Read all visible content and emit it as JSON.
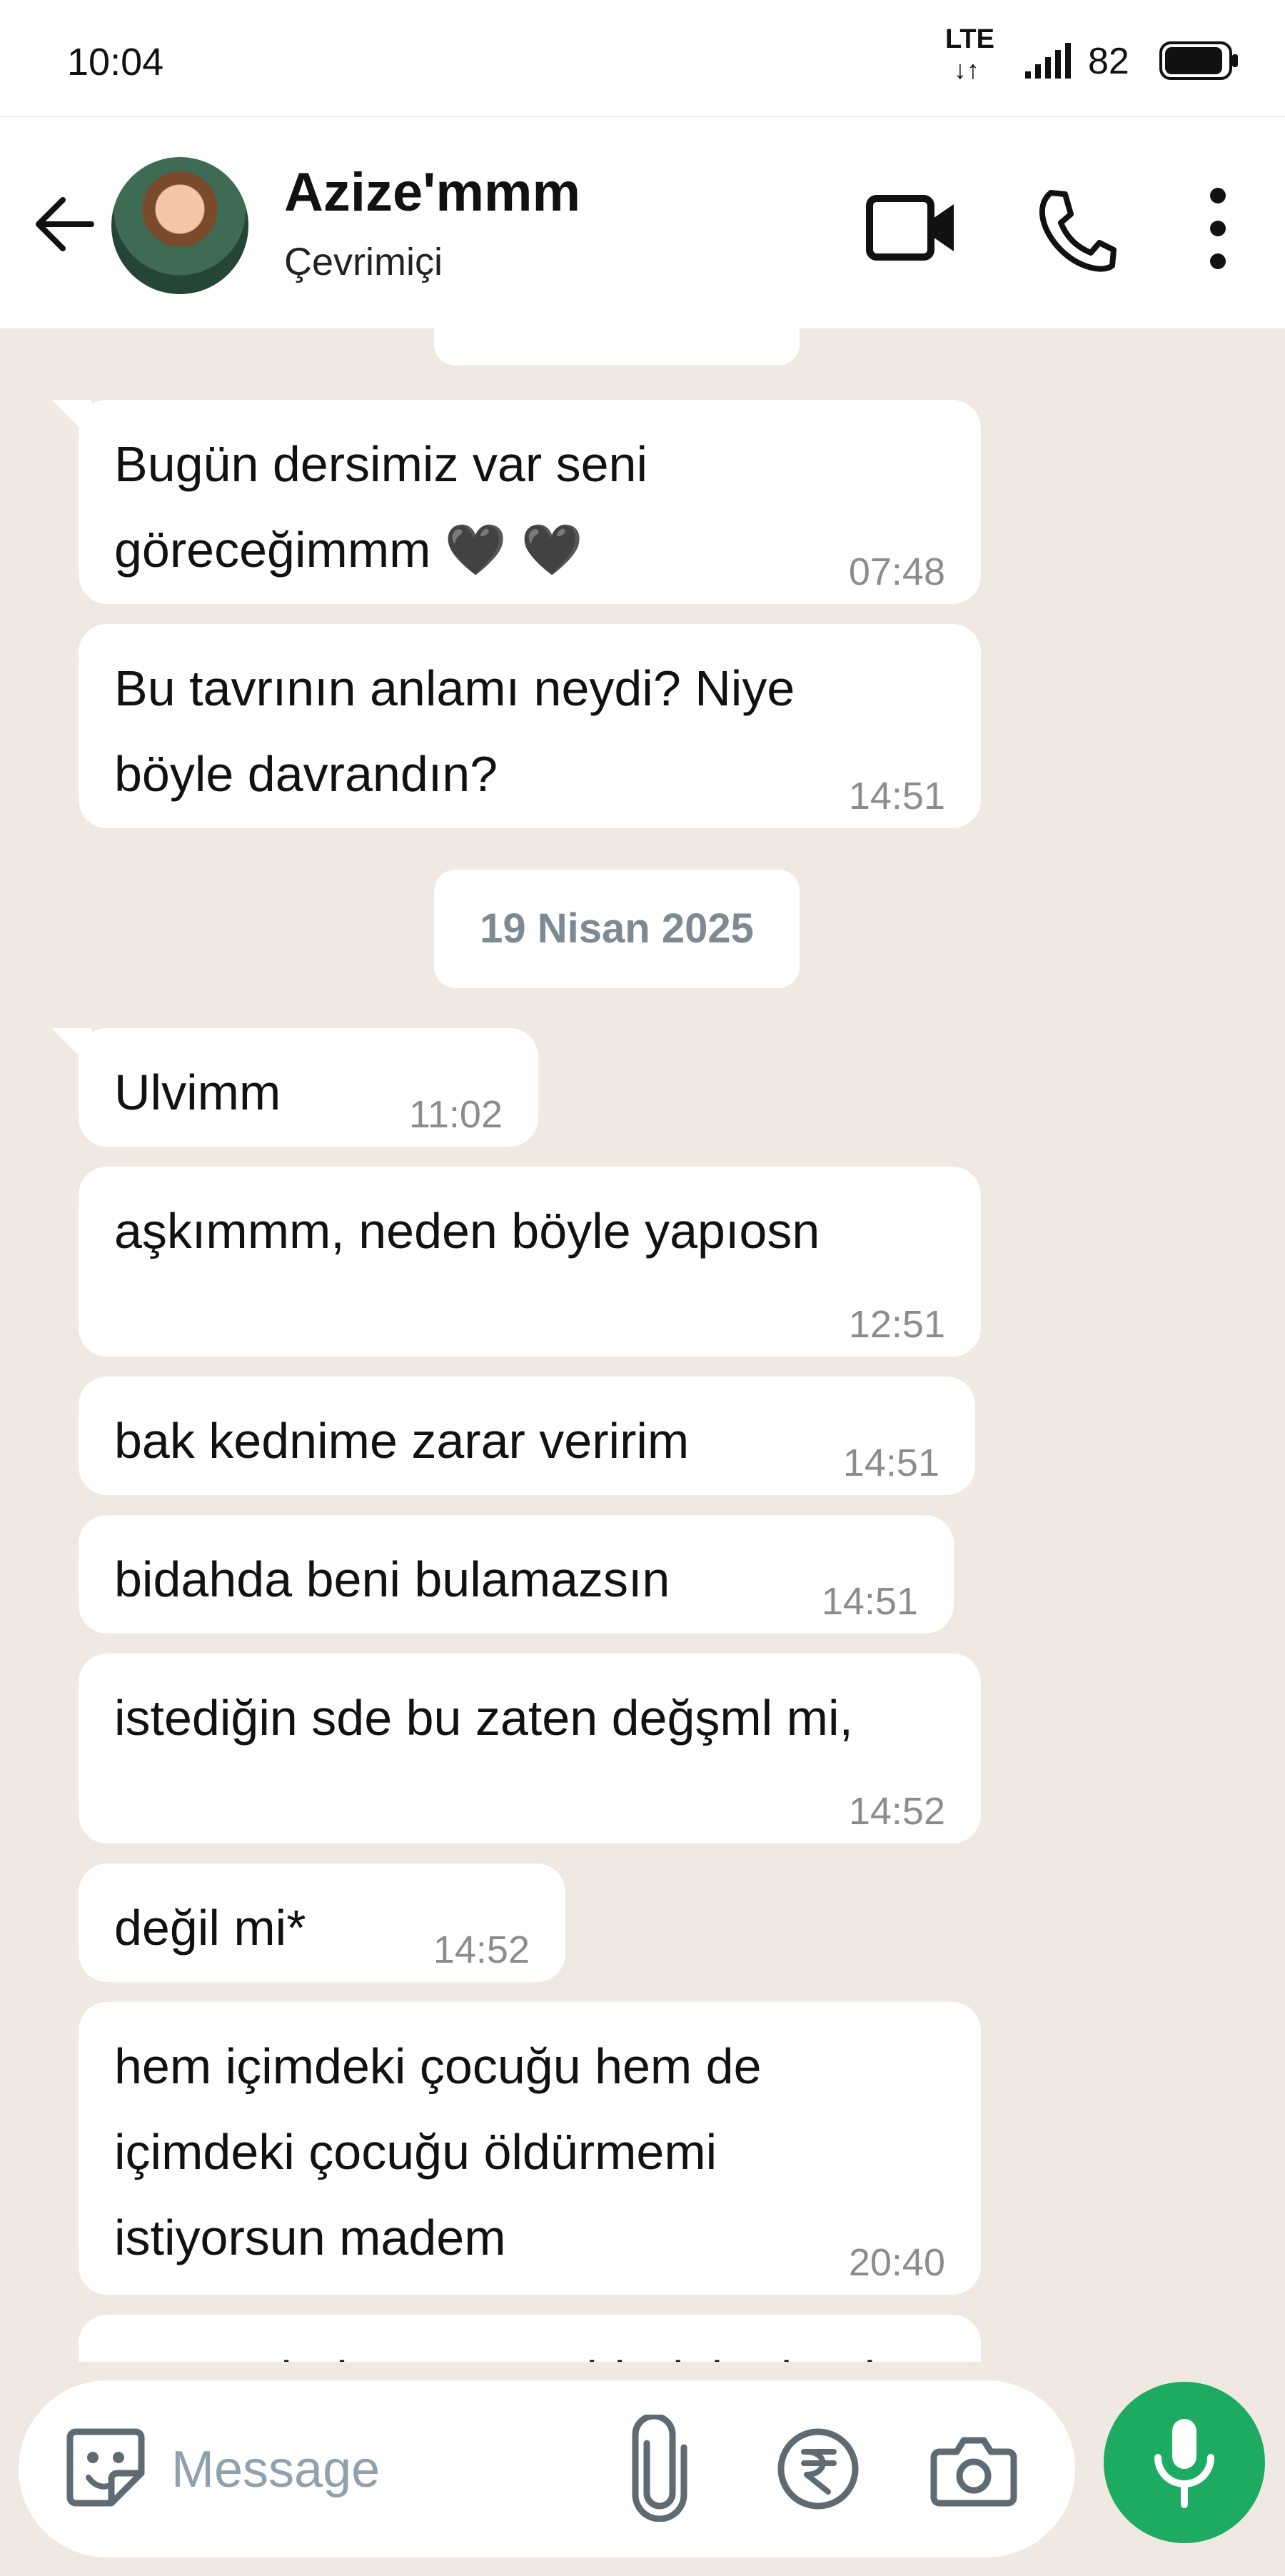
{
  "status_bar": {
    "time": "10:04",
    "network": "LTE",
    "network_arrows": "↓↑",
    "battery_percent": "82",
    "icons": [
      "signal-icon",
      "battery-icon"
    ]
  },
  "header": {
    "contact_name": "Azize'mmm",
    "contact_status": "Çevrimiçi",
    "icons": [
      "back-arrow-icon",
      "video-call-icon",
      "phone-call-icon",
      "more-menu-icon"
    ]
  },
  "chat": {
    "date_separator": "19 Nisan 2025",
    "messages": [
      {
        "text": "Bugün dersimiz var seni\ngöreceğimmm 🖤 🖤",
        "time": "07:48"
      },
      {
        "text": "Bu tavrının anlamı neydi? Niye\nböyle davrandın?",
        "time": "14:51"
      },
      {
        "text": "Ulvimm",
        "time": "11:02"
      },
      {
        "text": "aşkımmm, neden böyle yapıosn",
        "time": "12:51"
      },
      {
        "text": "bak kednime zarar veririm",
        "time": "14:51"
      },
      {
        "text": "bidahda beni bulamazsın",
        "time": "14:51"
      },
      {
        "text": "istediğin sde bu zaten değşml mi,",
        "time": "14:52"
      },
      {
        "text": "değil mi*",
        "time": "14:52"
      },
      {
        "text": "hem içimdeki çocuğu hem de\niçimdeki çocuğu öldürmemi\nistiyorsun madem",
        "time": "20:40"
      },
      {
        "text": "tamam bak görürsün bir daha beni",
        "time": ""
      }
    ]
  },
  "composer": {
    "placeholder": "Message",
    "icons": [
      "sticker-emoji-icon",
      "paperclip-icon",
      "rupee-payment-icon",
      "camera-icon",
      "microphone-icon"
    ]
  },
  "colors": {
    "chat_background": "#efe9e2",
    "bubble": "#ffffff",
    "accent_green": "#1daa61",
    "date_text": "#7d8a93"
  }
}
